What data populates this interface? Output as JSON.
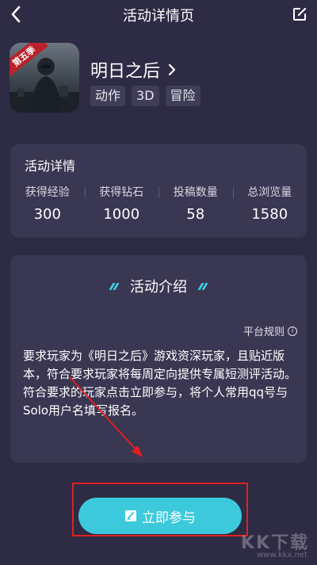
{
  "header": {
    "title": "活动详情页",
    "back_icon": "chevron-left-icon",
    "edit_icon": "edit-icon"
  },
  "game": {
    "season_badge": "第五季",
    "name": "明日之后",
    "tags": [
      "动作",
      "3D",
      "冒险"
    ]
  },
  "stats": {
    "title": "活动详情",
    "items": [
      {
        "label": "获得经验",
        "value": "300"
      },
      {
        "label": "获得钻石",
        "value": "1000"
      },
      {
        "label": "投稿数量",
        "value": "58"
      },
      {
        "label": "总浏览量",
        "value": "1580"
      }
    ]
  },
  "intro": {
    "heading": "活动介绍",
    "rules_label": "平台规则",
    "paragraphs": [
      "要求玩家为《明日之后》游戏资深玩家，且贴近版本，符合要求玩家将每周定向提供专属短测评活动。",
      "符合要求的玩家点击立即参与，将个人常用qq号与Solo用户名填写报名。"
    ]
  },
  "action": {
    "join_label": "立即参与"
  },
  "watermark": {
    "big": "KK下载",
    "small": "www.kkx.net"
  },
  "colors": {
    "background": "#2e2b45",
    "card": "#3a3753",
    "accent": "#3cc9db",
    "annotation": "#e12020"
  }
}
